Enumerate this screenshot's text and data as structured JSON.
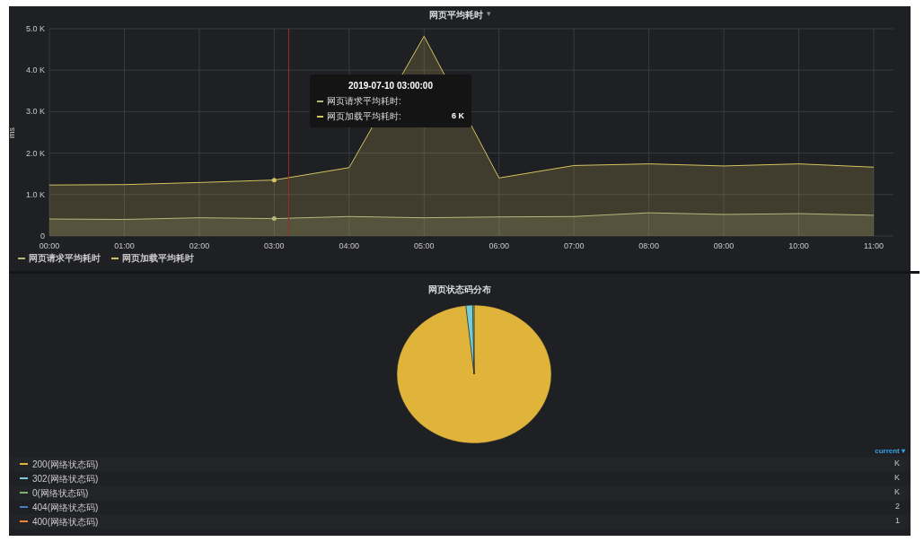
{
  "top_panel": {
    "title": "网页平均耗时",
    "title_menu": "▾",
    "chart_data": {
      "type": "area",
      "grid": true,
      "ylabel": "ms",
      "x": [
        "00:00",
        "01:00",
        "02:00",
        "03:00",
        "04:00",
        "05:00",
        "06:00",
        "07:00",
        "08:00",
        "09:00",
        "10:00",
        "11:00"
      ],
      "series": [
        {
          "name": "网页请求平均耗时",
          "color": "#b5b87a",
          "values": [
            410,
            400,
            440,
            420,
            470,
            440,
            460,
            470,
            560,
            520,
            540,
            500
          ]
        },
        {
          "name": "网页加载平均耗时",
          "color": "#d6c35e",
          "values": [
            1230,
            1240,
            1290,
            1350,
            1650,
            4820,
            1400,
            1700,
            1740,
            1690,
            1740,
            1660
          ]
        }
      ],
      "ylim": [
        0,
        5000
      ],
      "yticks": [
        {
          "value": 0,
          "label": "0"
        },
        {
          "value": 1000,
          "label": "1.0 K"
        },
        {
          "value": 2000,
          "label": "2.0 K"
        },
        {
          "value": 3000,
          "label": "3.0 K"
        },
        {
          "value": 4000,
          "label": "4.0 K"
        },
        {
          "value": 5000,
          "label": "5.0 K"
        }
      ]
    },
    "tooltip": {
      "title": "2019-07-10 03:00:00",
      "rows": [
        {
          "label": "网页请求平均耗时:",
          "color": "#b5b87a"
        },
        {
          "label": "网页加载平均耗时:",
          "value": "6 K",
          "color": "#d6c35e"
        }
      ]
    }
  },
  "bottom_panel": {
    "title": "网页状态码分布",
    "column_header": "current ▾",
    "legend": [
      {
        "label": "200(网络状态码)",
        "value": "K",
        "color": "#e0b43a"
      },
      {
        "label": "302(网络状态码)",
        "value": "K",
        "color": "#76cdd6"
      },
      {
        "label": "0(网络状态码)",
        "value": "K",
        "color": "#7eb26d"
      },
      {
        "label": "404(网络状态码)",
        "value": "2",
        "color": "#447ebc"
      },
      {
        "label": "400(网络状态码)",
        "value": "1",
        "color": "#ef843c"
      }
    ]
  }
}
